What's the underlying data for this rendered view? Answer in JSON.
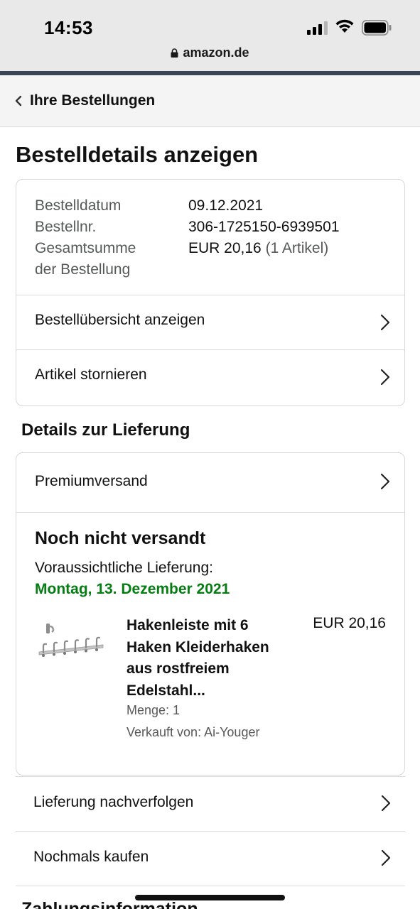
{
  "status_bar": {
    "time": "14:53"
  },
  "browser": {
    "url": "amazon.de"
  },
  "nav": {
    "back_label": "Ihre Bestellungen"
  },
  "page": {
    "title": "Bestelldetails anzeigen"
  },
  "order": {
    "date_label": "Bestelldatum",
    "date_value": "09.12.2021",
    "number_label": "Bestellnr.",
    "number_value": "306-1725150-6939501",
    "total_label_line1": "Gesamtsumme",
    "total_label_line2": "der Bestellung",
    "total_value": "EUR 20,16",
    "total_items": "(1 Artikel)",
    "links": {
      "summary": "Bestellübersicht anzeigen",
      "cancel": "Artikel stornieren"
    }
  },
  "delivery": {
    "section_title": "Details zur Lieferung",
    "shipping_method": "Premiumversand",
    "status": "Noch nicht versandt",
    "expected_label": "Voraussichtliche Lieferung:",
    "expected_date": "Montag, 13. Dezember 2021",
    "expected_date_color": "#067d12",
    "product": {
      "title": "Hakenleiste mit 6 Haken Kleiderhaken aus rostfreiem Edelstahl...",
      "price": "EUR 20,16",
      "quantity": "Menge: 1",
      "seller": "Verkauft von: Ai-Youger"
    }
  },
  "actions": {
    "track": "Lieferung nachverfolgen",
    "buy_again": "Nochmals kaufen"
  },
  "next_section": {
    "title": "Zahlungsinformation"
  },
  "colors": {
    "accent_bar": "#3a4553",
    "muted_text": "#565959",
    "border": "#d5d9d9"
  }
}
